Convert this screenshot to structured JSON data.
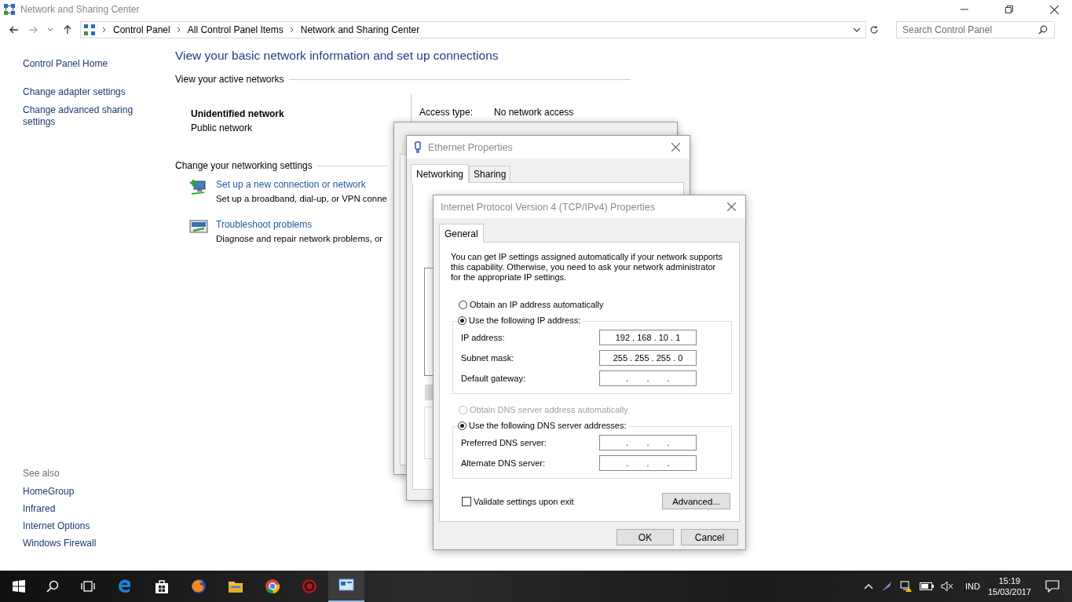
{
  "window": {
    "title": "Network and Sharing Center"
  },
  "address_bar": {
    "breadcrumbs": [
      "Control Panel",
      "All Control Panel Items",
      "Network and Sharing Center"
    ]
  },
  "search": {
    "placeholder": "Search Control Panel"
  },
  "sidebar": {
    "items": [
      "Control Panel Home",
      "Change adapter settings",
      "Change advanced sharing settings"
    ],
    "see_also": {
      "title": "See also",
      "items": [
        "HomeGroup",
        "Infrared",
        "Internet Options",
        "Windows Firewall"
      ]
    }
  },
  "main": {
    "heading": "View your basic network information and set up connections",
    "active_networks": {
      "title": "View your active networks",
      "network_name": "Unidentified network",
      "network_type": "Public network",
      "access_label": "Access type:",
      "access_value": "No network access"
    },
    "settings": {
      "title": "Change your networking settings",
      "tasks": [
        {
          "kind": "connection",
          "link": "Set up a new connection or network",
          "description": "Set up a broadband, dial-up, or VPN conne"
        },
        {
          "kind": "troubleshoot",
          "link": "Troubleshoot problems",
          "description": "Diagnose and repair network problems, or"
        }
      ]
    }
  },
  "ethernet_properties": {
    "title": "Ethernet Properties",
    "tabs": [
      {
        "label": "Networking",
        "selected": true
      },
      {
        "label": "Sharing",
        "selected": false
      }
    ]
  },
  "ipv4_dialog": {
    "title": "Internet Protocol Version 4 (TCP/IPv4) Properties",
    "tabs": [
      {
        "label": "General",
        "selected": true
      }
    ],
    "intro": "You can get IP settings assigned automatically if your network supports this capability. Otherwise, you need to ask your network administrator for the appropriate IP settings.",
    "ip_options": [
      {
        "label": "Obtain an IP address automatically",
        "selected": false,
        "disabled": false
      },
      {
        "label": "Use the following IP address:",
        "selected": true,
        "disabled": false
      }
    ],
    "ip_fields": [
      {
        "label": "IP address:",
        "kind": "filled",
        "value": "192 . 168 . 10 . 1"
      },
      {
        "label": "Subnet mask:",
        "kind": "filled",
        "value": "255 . 255 . 255 . 0"
      },
      {
        "label": "Default gateway:",
        "kind": "blank",
        "value": ". . ."
      }
    ],
    "dns_options": [
      {
        "label": "Obtain DNS server address automatically",
        "selected": false,
        "disabled": true
      },
      {
        "label": "Use the following DNS server addresses:",
        "selected": true,
        "disabled": false
      }
    ],
    "dns_fields": [
      {
        "label": "Preferred DNS server:",
        "kind": "blank",
        "value": ". . ."
      },
      {
        "label": "Alternate DNS server:",
        "kind": "blank",
        "value": ". . ."
      }
    ],
    "validate": {
      "label": "Validate settings upon exit",
      "checked": false
    },
    "advanced_button": "Advanced...",
    "buttons": [
      "OK",
      "Cancel"
    ]
  },
  "taskbar": {
    "language": "IND",
    "time": "15:19",
    "date": "15/03/2017"
  }
}
